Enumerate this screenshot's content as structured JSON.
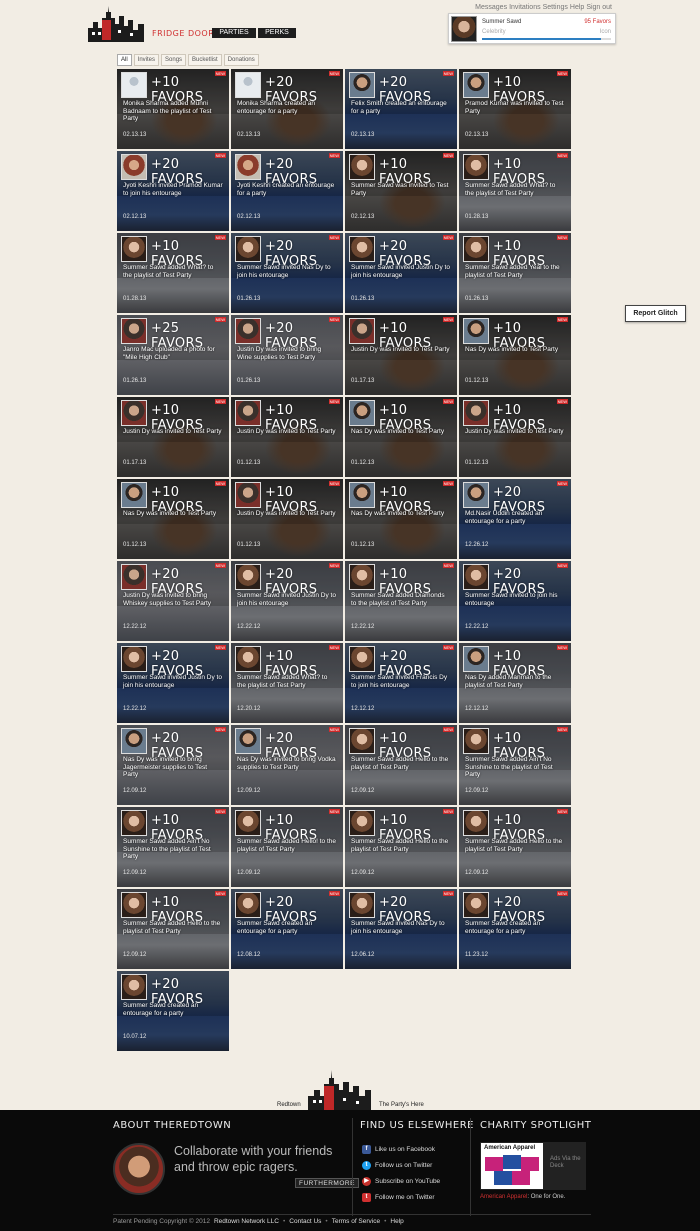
{
  "toplinks": [
    "Messages",
    "Invitations",
    "Settings",
    "Help",
    "Sign out"
  ],
  "header": {
    "brand": "FRIDGE DOOR",
    "nav": [
      "PARTIES",
      "PERKS"
    ]
  },
  "user": {
    "name": "Summer Sawd",
    "favors": "95 Favors",
    "rank": "Celebrity",
    "next_rank": "Icon",
    "progress": 0.92
  },
  "filters": [
    "All",
    "Invites",
    "Songs",
    "Bucketlist",
    "Donations"
  ],
  "feed": [
    {
      "pts": "+10 FAVORS",
      "desc": "Monika Sharma added Munni Badnaam to the playlist of Test Party",
      "date": "02.13.13",
      "new": true,
      "bg": "bg-dark",
      "ava": "ava-blank"
    },
    {
      "pts": "+20 FAVORS",
      "desc": "Monika Sharma created an entourage for a party",
      "date": "02.13.13",
      "new": true,
      "bg": "bg-dark",
      "ava": "ava-blank"
    },
    {
      "pts": "+20 FAVORS",
      "desc": "Felix Smith created an entourage for a party",
      "date": "02.13.13",
      "new": true,
      "bg": "bg-ocean",
      "ava": "ava-m"
    },
    {
      "pts": "+10 FAVORS",
      "desc": "Pramod Kumar was invited to Test Party",
      "date": "02.13.13",
      "new": true,
      "bg": "bg-dark",
      "ava": "ava-m"
    },
    {
      "pts": "+20 FAVORS",
      "desc": "Jyoti Keshri invited Pramod Kumar to join his entourage",
      "date": "02.12.13",
      "new": true,
      "bg": "bg-ocean",
      "ava": "ava-g"
    },
    {
      "pts": "+20 FAVORS",
      "desc": "Jyoti Keshri created an entourage for a party",
      "date": "02.12.13",
      "new": true,
      "bg": "bg-ocean",
      "ava": "ava-g"
    },
    {
      "pts": "+10 FAVORS",
      "desc": "Summer Sawd was invited to Test Party",
      "date": "02.12.13",
      "new": true,
      "bg": "bg-dark",
      "ava": "ava-f"
    },
    {
      "pts": "+10 FAVORS",
      "desc": "Summer Sawd added What? to the playlist of Test Party",
      "date": "01.28.13",
      "new": true,
      "bg": "bg-street",
      "ava": "ava-f"
    },
    {
      "pts": "+10 FAVORS",
      "desc": "Summer Sawd added What? to the playlist of Test Party",
      "date": "01.28.13",
      "new": true,
      "bg": "bg-street",
      "ava": "ava-f"
    },
    {
      "pts": "+20 FAVORS",
      "desc": "Summer Sawd invited Nas Dy to join his entourage",
      "date": "01.26.13",
      "new": true,
      "bg": "bg-ocean",
      "ava": "ava-f"
    },
    {
      "pts": "+20 FAVORS",
      "desc": "Summer Sawd invited Justin Dy to join his entourage",
      "date": "01.26.13",
      "new": true,
      "bg": "bg-ocean",
      "ava": "ava-f"
    },
    {
      "pts": "+10 FAVORS",
      "desc": "Summer Sawd added Yeal to the playlist of Test Party",
      "date": "01.26.13",
      "new": true,
      "bg": "bg-street",
      "ava": "ava-f"
    },
    {
      "pts": "+25 FAVORS",
      "desc": "Janro Mac uploaded a photo for \"Mile High Club\"",
      "date": "01.26.13",
      "new": true,
      "bg": "bg-mixed",
      "ava": "ava-j"
    },
    {
      "pts": "+20 FAVORS",
      "desc": "Justin Dy was invited to bring Wine supplies to Test Party",
      "date": "01.26.13",
      "new": true,
      "bg": "bg-mixed",
      "ava": "ava-j"
    },
    {
      "pts": "+10 FAVORS",
      "desc": "Justin Dy was invited to Test Party",
      "date": "01.17.13",
      "new": true,
      "bg": "bg-dark",
      "ava": "ava-j"
    },
    {
      "pts": "+10 FAVORS",
      "desc": "Nas Dy was invited to Test Party",
      "date": "01.12.13",
      "new": true,
      "bg": "bg-dark",
      "ava": "ava-m"
    },
    {
      "pts": "+10 FAVORS",
      "desc": "Justin Dy was invited to Test Party",
      "date": "01.17.13",
      "new": true,
      "bg": "bg-dark",
      "ava": "ava-j"
    },
    {
      "pts": "+10 FAVORS",
      "desc": "Justin Dy was invited to Test Party",
      "date": "01.12.13",
      "new": true,
      "bg": "bg-dark",
      "ava": "ava-j"
    },
    {
      "pts": "+10 FAVORS",
      "desc": "Nas Dy was invited to Test Party",
      "date": "01.12.13",
      "new": true,
      "bg": "bg-dark",
      "ava": "ava-m"
    },
    {
      "pts": "+10 FAVORS",
      "desc": "Justin Dy was invited to Test Party",
      "date": "01.12.13",
      "new": true,
      "bg": "bg-dark",
      "ava": "ava-j"
    },
    {
      "pts": "+10 FAVORS",
      "desc": "Nas Dy was invited to Test Party",
      "date": "01.12.13",
      "new": true,
      "bg": "bg-dark",
      "ava": "ava-m"
    },
    {
      "pts": "+10 FAVORS",
      "desc": "Justin Dy was invited to Test Party",
      "date": "01.12.13",
      "new": true,
      "bg": "bg-dark",
      "ava": "ava-j"
    },
    {
      "pts": "+10 FAVORS",
      "desc": "Nas Dy was invited to Test Party",
      "date": "01.12.13",
      "new": true,
      "bg": "bg-dark",
      "ava": "ava-m"
    },
    {
      "pts": "+20 FAVORS",
      "desc": "Md.Nasir Uddin created an entourage for a party",
      "date": "12.26.12",
      "new": true,
      "bg": "bg-ocean",
      "ava": "ava-m"
    },
    {
      "pts": "+20 FAVORS",
      "desc": "Justin Dy was invited to bring Whiskey supplies to Test Party",
      "date": "12.22.12",
      "new": true,
      "bg": "bg-mixed",
      "ava": "ava-j"
    },
    {
      "pts": "+20 FAVORS",
      "desc": "Summer Sawd invited Justin Dy to join his entourage",
      "date": "12.22.12",
      "new": true,
      "bg": "bg-street",
      "ava": "ava-f"
    },
    {
      "pts": "+10 FAVORS",
      "desc": "Summer Sawd added Diamonds to the playlist of Test Party",
      "date": "12.22.12",
      "new": true,
      "bg": "bg-street",
      "ava": "ava-f"
    },
    {
      "pts": "+20 FAVORS",
      "desc": "Summer Sawd invited to join his entourage",
      "date": "12.22.12",
      "new": true,
      "bg": "bg-ocean",
      "ava": "ava-f"
    },
    {
      "pts": "+20 FAVORS",
      "desc": "Summer Sawd invited Justin Dy to join his entourage",
      "date": "12.22.12",
      "new": true,
      "bg": "bg-ocean",
      "ava": "ava-f"
    },
    {
      "pts": "+10 FAVORS",
      "desc": "Summer Sawd added What? to the playlist of Test Party",
      "date": "12.20.12",
      "new": true,
      "bg": "bg-street",
      "ava": "ava-f"
    },
    {
      "pts": "+20 FAVORS",
      "desc": "Summer Sawd invited Francis Dy to join his entourage",
      "date": "12.12.12",
      "new": true,
      "bg": "bg-ocean",
      "ava": "ava-f"
    },
    {
      "pts": "+10 FAVORS",
      "desc": "Nas Dy added Manman to the playlist of Test Party",
      "date": "12.12.12",
      "new": true,
      "bg": "bg-street",
      "ava": "ava-m"
    },
    {
      "pts": "+20 FAVORS",
      "desc": "Nas Dy was invited to bring Jagermeister supplies to Test Party",
      "date": "12.09.12",
      "new": true,
      "bg": "bg-mixed",
      "ava": "ava-m"
    },
    {
      "pts": "+20 FAVORS",
      "desc": "Nas Dy was invited to bring Vodka supplies to Test Party",
      "date": "12.09.12",
      "new": true,
      "bg": "bg-mixed",
      "ava": "ava-m"
    },
    {
      "pts": "+10 FAVORS",
      "desc": "Summer Sawd added Hello to the playlist of Test Party",
      "date": "12.09.12",
      "new": true,
      "bg": "bg-street",
      "ava": "ava-f"
    },
    {
      "pts": "+10 FAVORS",
      "desc": "Summer Sawd added Ain't No Sunshine to the playlist of Test Party",
      "date": "12.09.12",
      "new": true,
      "bg": "bg-street",
      "ava": "ava-f"
    },
    {
      "pts": "+10 FAVORS",
      "desc": "Summer Sawd added Ain't No Sunshine to the playlist of Test Party",
      "date": "12.09.12",
      "new": true,
      "bg": "bg-street",
      "ava": "ava-f"
    },
    {
      "pts": "+10 FAVORS",
      "desc": "Summer Sawd added Hello! to the playlist of Test Party",
      "date": "12.09.12",
      "new": true,
      "bg": "bg-street",
      "ava": "ava-f"
    },
    {
      "pts": "+10 FAVORS",
      "desc": "Summer Sawd added Hello to the playlist of Test Party",
      "date": "12.09.12",
      "new": true,
      "bg": "bg-street",
      "ava": "ava-f"
    },
    {
      "pts": "+10 FAVORS",
      "desc": "Summer Sawd added Hello to the playlist of Test Party",
      "date": "12.09.12",
      "new": true,
      "bg": "bg-street",
      "ava": "ava-f"
    },
    {
      "pts": "+10 FAVORS",
      "desc": "Summer Sawd added Hello to the playlist of Test Party",
      "date": "12.09.12",
      "new": true,
      "bg": "bg-street",
      "ava": "ava-f"
    },
    {
      "pts": "+20 FAVORS",
      "desc": "Summer Sawd created an entourage for a party",
      "date": "12.08.12",
      "new": true,
      "bg": "bg-ocean",
      "ava": "ava-f"
    },
    {
      "pts": "+20 FAVORS",
      "desc": "Summer Sawd invited Nas Dy to join his entourage",
      "date": "12.06.12",
      "new": true,
      "bg": "bg-ocean",
      "ava": "ava-f"
    },
    {
      "pts": "+20 FAVORS",
      "desc": "Summer Sawd created an entourage for a party",
      "date": "11.23.12",
      "new": true,
      "bg": "bg-ocean",
      "ava": "ava-f"
    },
    {
      "pts": "+20 FAVORS",
      "desc": "Summer Sawd created an entourage for a party",
      "date": "10.07.12",
      "new": false,
      "bg": "bg-ocean",
      "ava": "ava-f"
    }
  ],
  "report_glitch": "Report Glitch",
  "footer_logo": {
    "left": "Redtown",
    "right": "The Party's Here"
  },
  "footer": {
    "about_title": "ABOUT THEREDTOWN",
    "about_text": "Collaborate with your friends and throw epic ragers.",
    "more_label": "FURTHERMORE",
    "find_title": "FIND US ELSEWHERE",
    "social": [
      {
        "label": "Like us on Facebook",
        "icon": "facebook-icon",
        "glyph": "f",
        "cls": "ic-fb"
      },
      {
        "label": "Follow us on Twitter",
        "icon": "twitter-icon",
        "glyph": "t",
        "cls": "ic-tw"
      },
      {
        "label": "Subscribe on YouTube",
        "icon": "youtube-icon",
        "glyph": "▶",
        "cls": "ic-yt"
      },
      {
        "label": "Follow me on Twitter",
        "icon": "twitter-icon",
        "glyph": "t",
        "cls": "ic-tw2"
      }
    ],
    "charity_title": "CHARITY SPOTLIGHT",
    "charity_brand": "American Apparel",
    "charity_deck": "Ads Via the Deck",
    "charity_caption_hl": "American Apparel",
    "charity_caption": ": One for One.",
    "copyright": "Patent Pending Copyright © 2012",
    "company": "Redtown Network LLC",
    "contact": "Contact Us",
    "terms": "Terms of Service",
    "help": "Help"
  },
  "colors": {
    "accent": "#d03030",
    "footer_bg": "#0a0a0a",
    "page_bg": "#f2ede4"
  }
}
